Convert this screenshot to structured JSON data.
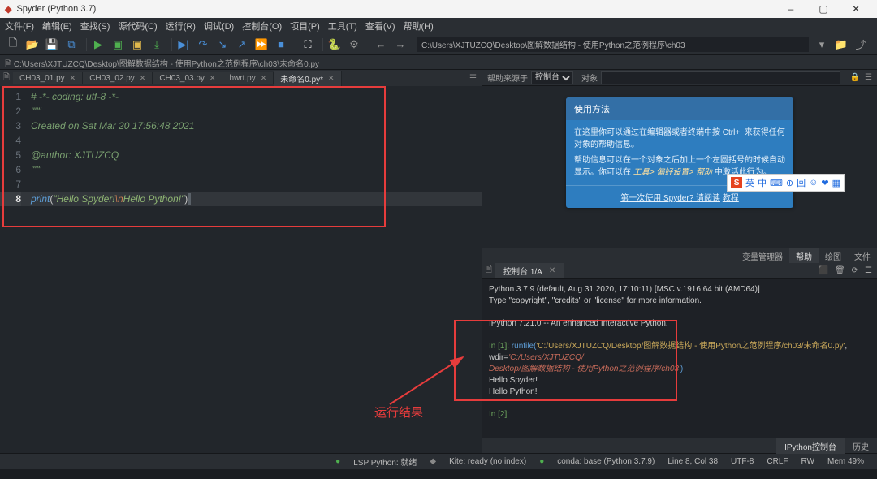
{
  "title": "Spyder (Python 3.7)",
  "menus": [
    "文件(F)",
    "编辑(E)",
    "查找(S)",
    "源代码(C)",
    "运行(R)",
    "调试(D)",
    "控制台(O)",
    "项目(P)",
    "工具(T)",
    "查看(V)",
    "帮助(H)"
  ],
  "toolbar_path": "C:\\Users\\XJTUZCQ\\Desktop\\图解数据结构 - 使用Python之范例程序\\ch03",
  "pathbar": "C:\\Users\\XJTUZCQ\\Desktop\\图解数据结构 - 使用Python之范例程序\\ch03\\未命名0.py",
  "tabs": [
    {
      "label": "CH03_01.py",
      "active": false
    },
    {
      "label": "CH03_02.py",
      "active": false
    },
    {
      "label": "CH03_03.py",
      "active": false
    },
    {
      "label": "hwrt.py",
      "active": false
    },
    {
      "label": "未命名0.py*",
      "active": true
    }
  ],
  "gutter": [
    "1",
    "2",
    "3",
    "4",
    "5",
    "6",
    "7",
    "8"
  ],
  "current_line": 8,
  "code": {
    "l1": "# -*- coding: utf-8 -*-",
    "l2": "\"\"\"",
    "l3": "Created on Sat Mar 20 17:56:48 2021",
    "l4": "",
    "l5": "@author: XJTUZCQ",
    "l6": "\"\"\"",
    "l7": "",
    "l8_kw": "print",
    "l8_str1": "\"Hello Spyder!",
    "l8_esc": "\\n",
    "l8_str2": "Hello Python!\""
  },
  "help": {
    "source_label": "帮助来源于",
    "source_value": "控制台",
    "object_label": "对象",
    "card_head": "使用方法",
    "card_line1": "在这里你可以通过在编辑器或者终端中按 Ctrl+I 来获得任何对象的帮助信息。",
    "card_line2": "帮助信息可以在一个对象之后加上一个左圆括号的时候自动显示。你可以在 ",
    "card_line2_em": "工具> 偏好设置> 帮助",
    "card_line2_end": " 中激活此行为。",
    "card_foot": "第一次使用 Spyder? 请阅读",
    "card_foot_link": "教程"
  },
  "minitabs": [
    "变量管理器",
    "帮助",
    "绘图",
    "文件"
  ],
  "minitab_active": 1,
  "console_tab": "控制台 1/A",
  "console_lines": [
    {
      "cls": "con-w",
      "text": "Python 3.7.9 (default, Aug 31 2020, 17:10:11) [MSC v.1916 64 bit (AMD64)]"
    },
    {
      "cls": "con-w",
      "text": "Type \"copyright\", \"credits\" or \"license\" for more information."
    },
    {
      "cls": "",
      "text": " "
    },
    {
      "cls": "con-w",
      "text": "IPython 7.21.0 -- An enhanced Interactive Python."
    },
    {
      "cls": "",
      "text": " "
    },
    {
      "cls": "in1",
      "text": ""
    },
    {
      "cls": "in1b",
      "text": ""
    },
    {
      "cls": "con-w",
      "text": "Hello Spyder!"
    },
    {
      "cls": "con-w",
      "text": "Hello Python!"
    },
    {
      "cls": "",
      "text": " "
    },
    {
      "cls": "in2",
      "text": ""
    }
  ],
  "in1_prompt": "In [1]: ",
  "in1_call": "runfile(",
  "in1_arg1": "'C:/Users/XJTUZCQ/Desktop/图解数据结构 - 使用Python之范例程序/ch03/未命名0.py'",
  "in1_wdir": ", wdir=",
  "in1_arg2": "'C:/Users/XJTUZCQ/",
  "in1b_text": "Desktop/图解数据结构 - 使用Python之范例程序/ch03'",
  "in1_close": ")",
  "in2_prompt": "In [2]: ",
  "contabs": [
    "IPython控制台",
    "历史"
  ],
  "contab_active": 0,
  "status": {
    "lsp": "LSP Python: 就绪",
    "kite": "Kite: ready (no index)",
    "conda": "conda: base (Python 3.7.9)",
    "linecol": "Line 8, Col 38",
    "enc": "UTF-8",
    "eol": "CRLF",
    "rw": "RW",
    "mem": "Mem 49%"
  },
  "run_label": "运行结果",
  "ime": {
    "s": "S",
    "chars": [
      "英",
      "中",
      "⌨",
      "⊕",
      "回",
      "☺",
      "❤",
      "▦"
    ]
  }
}
